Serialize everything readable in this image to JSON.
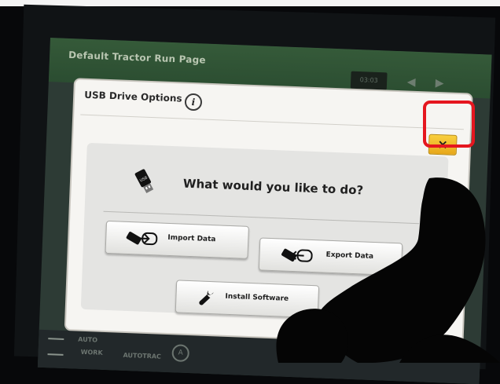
{
  "app": {
    "title": "Default Tractor Run Page",
    "clock": "03:03"
  },
  "dialog": {
    "title": "USB Drive Options",
    "question": "What would you like to do?",
    "close_label": "×",
    "buttons": {
      "import": "Import Data",
      "export": "Export Data",
      "install": "Install Software"
    }
  },
  "bottom_bar": {
    "auto_label": "AUTO",
    "work_label": "WORK",
    "autotrac_label": "AUTOTRAC",
    "a_label": "A"
  },
  "colors": {
    "highlight": "#e5161f",
    "close_button": "#f2bb2c",
    "screen_header": "#2b4d31"
  },
  "icons": [
    "info-icon",
    "usb-drive-icon",
    "import-icon",
    "export-icon",
    "wrench-icon",
    "close-icon",
    "arrow-left-icon",
    "arrow-right-icon"
  ]
}
